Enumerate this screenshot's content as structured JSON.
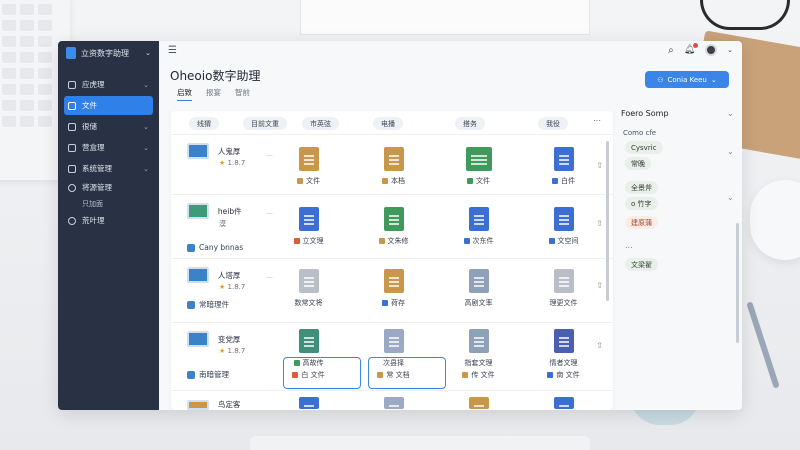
{
  "sidebar": {
    "title": "立资数字助理",
    "items": [
      {
        "label": "应虎理",
        "active": false
      },
      {
        "label": "文件",
        "active": true
      },
      {
        "label": "很储",
        "active": false
      },
      {
        "label": "营盒理",
        "active": false
      },
      {
        "label": "系统管理",
        "active": false
      }
    ],
    "subitems": [
      "将源管理",
      "只加面",
      "荒叶理"
    ]
  },
  "header": {
    "title": "Oheoio数字助理",
    "tabs": [
      "启致",
      "报宴",
      "智前"
    ],
    "primary_button": "Conia Keeu"
  },
  "columns": [
    "线猬",
    "目前文重",
    "市英弦",
    "电播",
    "搭务",
    "我役"
  ],
  "rows": [
    {
      "name": "人鬼厚",
      "rating": "1.8.7",
      "files": [
        {
          "label": "文件",
          "color": "#c9974a"
        },
        {
          "label": "本档",
          "color": "#c9974a"
        },
        {
          "label": "文件",
          "color": "#3f9a5c"
        },
        {
          "label": "白件",
          "color": "#3b6fd4"
        }
      ]
    },
    {
      "name": "heib件",
      "sub": "Cany bnnas",
      "name2": "漠",
      "files": [
        {
          "label": "立文理",
          "color": "#3b6fd4"
        },
        {
          "label": "文朱修",
          "color": "#3f9a5c"
        },
        {
          "label": "次东件",
          "color": "#3b6fd4"
        },
        {
          "label": "文空间",
          "color": "#3b6fd4"
        }
      ]
    },
    {
      "name": "人塔厚",
      "rating": "1.8.7",
      "sub": "常暗理件",
      "files": [
        {
          "label": "数常文将",
          "color": "#b9bec7"
        },
        {
          "label": "荷存",
          "color": "#c9974a"
        },
        {
          "label": "高剧文率",
          "color": "#8fa1b8"
        },
        {
          "label": "理更文件",
          "color": "#b9bec7"
        }
      ]
    },
    {
      "name": "变党厚",
      "rating": "1.8.7",
      "sub": "南暗管理",
      "files": [
        {
          "label": "高故传",
          "sub": "白 文件",
          "color": "#3f8f7a"
        },
        {
          "label": "次县择",
          "sub": "常 文档",
          "color": "#9ba9c4"
        },
        {
          "label": "指套文理",
          "sub": "传 文件",
          "color": "#8fa1b8"
        },
        {
          "label": "情者文理",
          "sub": "南 文件",
          "color": "#4a5fb0"
        }
      ]
    },
    {
      "name": "鸟定客",
      "files": [
        {
          "label": "",
          "color": "#3b6fd4"
        },
        {
          "label": "",
          "color": "#9ba9c4"
        },
        {
          "label": "",
          "color": "#c9974a"
        },
        {
          "label": "",
          "color": "#3b6fd4"
        }
      ]
    }
  ],
  "right_panel": {
    "title": "Foero Somp",
    "subtitle": "Como cfe",
    "tags": [
      {
        "label": "Cysvric",
        "type": "ok"
      },
      {
        "label": "常晚",
        "type": "ok"
      },
      {
        "label": "全景斧",
        "type": "ok"
      },
      {
        "label": "o 竹字",
        "type": "ok"
      },
      {
        "label": "建原蒲",
        "type": "warn"
      },
      {
        "label": "文梁翟",
        "type": "ok"
      }
    ],
    "dots": "..."
  },
  "colors": {
    "accent": "#3a86e8",
    "sidebar": "#283244"
  }
}
